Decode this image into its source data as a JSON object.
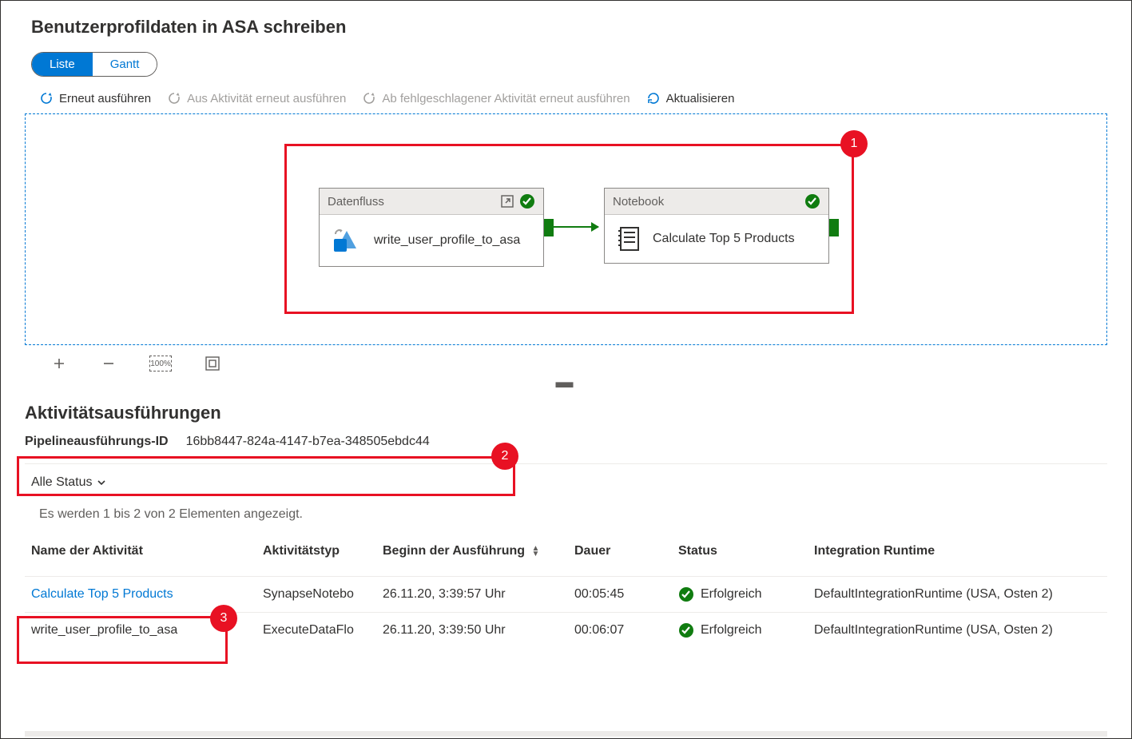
{
  "page_title": "Benutzerprofildaten in ASA schreiben",
  "view_toggle": {
    "list": "Liste",
    "gantt": "Gantt"
  },
  "toolbar": {
    "rerun": "Erneut ausführen",
    "rerun_from_activity": "Aus Aktivität erneut ausführen",
    "rerun_from_failed": "Ab fehlgeschlagener Aktivität erneut ausführen",
    "refresh": "Aktualisieren"
  },
  "canvas": {
    "activity1": {
      "type": "Datenfluss",
      "name": "write_user_profile_to_asa"
    },
    "activity2": {
      "type": "Notebook",
      "name": "Calculate Top 5 Products"
    }
  },
  "zoom": {
    "percent": "100%"
  },
  "section_title": "Aktivitätsausführungen",
  "run_id": {
    "label": "Pipelineausführungs-ID",
    "value": "16bb8447-824a-4147-b7ea-348505ebdc44"
  },
  "status_filter": "Alle Status",
  "count_text": "Es werden 1 bis 2 von 2 Elementen angezeigt.",
  "table": {
    "headers": {
      "name": "Name der Aktivität",
      "type": "Aktivitätstyp",
      "start": "Beginn der Ausführung",
      "duration": "Dauer",
      "status": "Status",
      "runtime": "Integration Runtime"
    },
    "rows": [
      {
        "name": "Calculate Top 5 Products",
        "type": "SynapseNotebo",
        "start": "26.11.20, 3:39:57 Uhr",
        "duration": "00:05:45",
        "status": "Erfolgreich",
        "runtime": "DefaultIntegrationRuntime (USA, Osten 2)"
      },
      {
        "name": "write_user_profile_to_asa",
        "type": "ExecuteDataFlo",
        "start": "26.11.20, 3:39:50 Uhr",
        "duration": "00:06:07",
        "status": "Erfolgreich",
        "runtime": "DefaultIntegrationRuntime (USA, Osten 2)"
      }
    ]
  },
  "annotations": {
    "n1": "1",
    "n2": "2",
    "n3": "3"
  }
}
